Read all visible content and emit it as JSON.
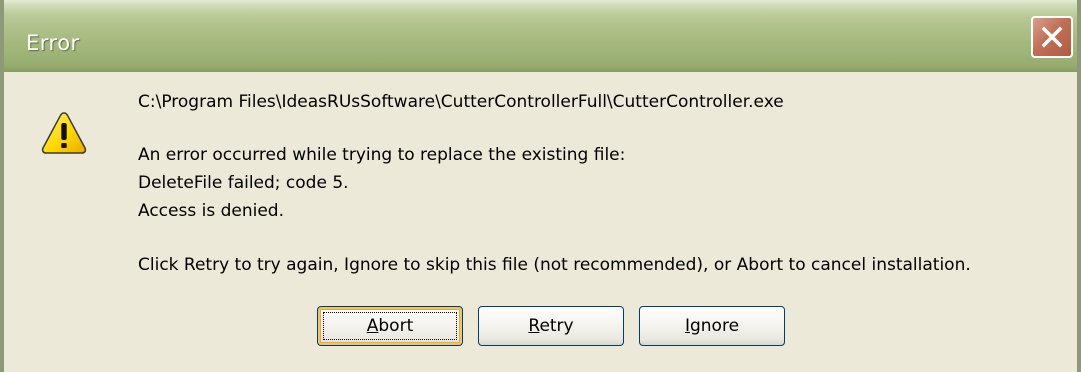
{
  "window": {
    "title": "Error"
  },
  "icons": {
    "warning": "warning-icon",
    "close": "close-icon"
  },
  "message": {
    "path": "C:\\Program Files\\IdeasRUsSoftware\\CutterControllerFull\\CutterController.exe",
    "error_line1": "An error occurred while trying to replace the existing file:",
    "error_line2": "DeleteFile failed; code 5.",
    "error_line3": "Access is denied.",
    "instruction": "Click Retry to try again, Ignore to skip this file (not recommended), or Abort to cancel installation."
  },
  "buttons": {
    "abort": {
      "mnemonic": "A",
      "rest": "bort"
    },
    "retry": {
      "mnemonic": "R",
      "rest": "etry"
    },
    "ignore": {
      "mnemonic": "I",
      "rest": "gnore"
    }
  },
  "colors": {
    "titlebar": "#a9bd84",
    "dialog_face": "#ece9d8",
    "close_button": "#c26f57",
    "warning_fill": "#ffd800"
  }
}
